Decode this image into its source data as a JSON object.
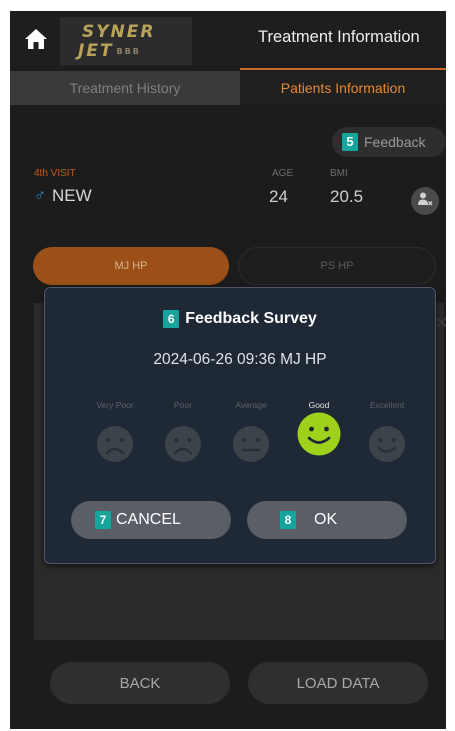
{
  "header": {
    "logo_line1": "SYNER",
    "logo_line2": "JET",
    "logo_small": "BBB",
    "title": "Treatment Information"
  },
  "tabs": [
    {
      "label": "Treatment History",
      "active": false
    },
    {
      "label": "Patients Information",
      "active": true
    }
  ],
  "feedback_button": {
    "badge": "5",
    "label": "Feedback"
  },
  "patient": {
    "visit_label": "4th VISIT",
    "visit_value": "NEW",
    "gender_icon": "male-icon",
    "age_label": "AGE",
    "age_value": "24",
    "bmi_label": "BMI",
    "bmi_value": "20.5"
  },
  "mode_pills": [
    {
      "label": "MJ HP",
      "active": true
    },
    {
      "label": "PS HP",
      "active": false
    }
  ],
  "dialog": {
    "title_badge": "6",
    "title": "Feedback Survey",
    "subtitle": "2024-06-26 09:36 MJ HP",
    "ratings": [
      {
        "label": "Very Poor",
        "face": "frown",
        "selected": false
      },
      {
        "label": "Poor",
        "face": "frown",
        "selected": false
      },
      {
        "label": "Average",
        "face": "neutral",
        "selected": false
      },
      {
        "label": "Good",
        "face": "smile",
        "selected": true
      },
      {
        "label": "Excellent",
        "face": "smile",
        "selected": false
      }
    ],
    "cancel": {
      "badge": "7",
      "label": "CANCEL"
    },
    "ok": {
      "badge": "8",
      "label": "OK"
    }
  },
  "bottom_buttons": {
    "back": "BACK",
    "load": "LOAD DATA"
  },
  "colors": {
    "accent_orange": "#e8872e",
    "badge_teal": "#15a59d",
    "selected_face": "#9ed11a",
    "dialog_bg": "#1f2935"
  }
}
